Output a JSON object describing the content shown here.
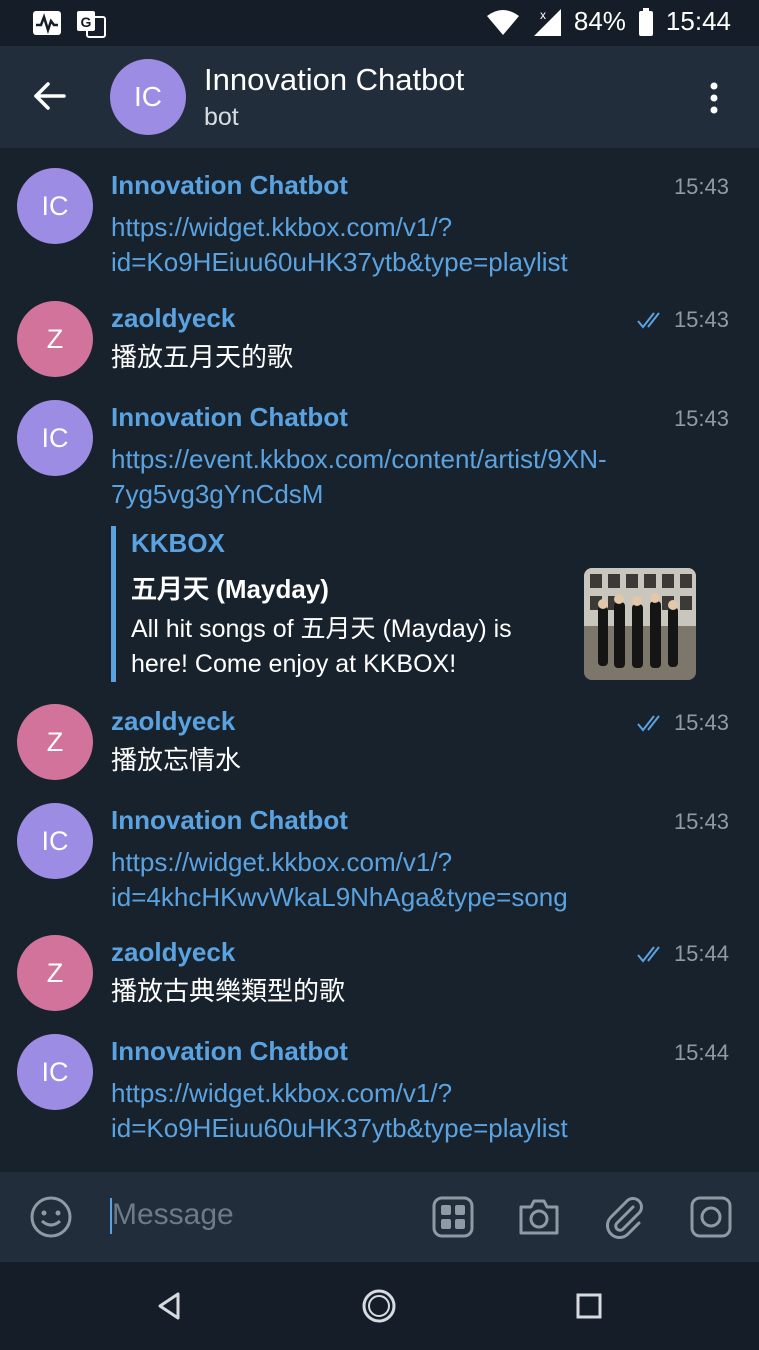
{
  "status": {
    "battery": "84%",
    "time": "15:44"
  },
  "header": {
    "avatar_initials": "IC",
    "title": "Innovation Chatbot",
    "subtitle": "bot"
  },
  "messages": [
    {
      "sender": "Innovation Chatbot",
      "initials": "IC",
      "time": "15:43",
      "lines": [
        "https://widget.kkbox.com/v1/?",
        "id=Ko9HEiuu60uHK37ytb&type=playlist"
      ]
    },
    {
      "sender": "zaoldyeck",
      "initials": "Z",
      "time": "15:43",
      "lines": [
        "播放五月天的歌"
      ]
    },
    {
      "sender": "Innovation Chatbot",
      "initials": "IC",
      "time": "15:43",
      "lines": [
        "https://event.kkbox.com/content/artist/9XN-",
        "7yg5vg3gYnCdsM"
      ],
      "preview": {
        "site": "KKBOX",
        "title": "五月天 (Mayday)",
        "desc": "All hit songs of 五月天 (Mayday) is here! Come enjoy at KKBOX!"
      }
    },
    {
      "sender": "zaoldyeck",
      "initials": "Z",
      "time": "15:43",
      "lines": [
        "播放忘情水"
      ]
    },
    {
      "sender": "Innovation Chatbot",
      "initials": "IC",
      "time": "15:43",
      "lines": [
        "https://widget.kkbox.com/v1/?",
        "id=4khcHKwvWkaL9NhAga&type=song"
      ]
    },
    {
      "sender": "zaoldyeck",
      "initials": "Z",
      "time": "15:44",
      "lines": [
        "播放古典樂類型的歌"
      ]
    },
    {
      "sender": "Innovation Chatbot",
      "initials": "IC",
      "time": "15:44",
      "lines": [
        "https://widget.kkbox.com/v1/?",
        "id=Ko9HEiuu60uHK37ytb&type=playlist"
      ]
    }
  ],
  "input": {
    "placeholder": "Message"
  },
  "colors": {
    "accent": "#5ba3e0",
    "bot_avatar": "#9c8ce3",
    "user_avatar": "#d2739c",
    "background": "#18222d"
  }
}
